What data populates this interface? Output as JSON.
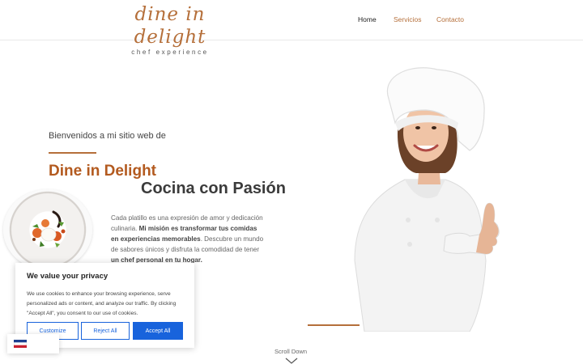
{
  "header": {
    "logo_main": "dine in delight",
    "logo_sub": "chef experience",
    "nav": {
      "home": "Home",
      "servicios": "Servicios",
      "contacto": "Contacto"
    }
  },
  "hero": {
    "welcome": "Bienvenidos a mi sitio web de",
    "title_1": "Dine in Delight",
    "title_2": "Cocina con Pasión",
    "para_1": "Cada platillo es una expresión de amor y dedicación culinaria. ",
    "para_bold_1": "Mi misión es transformar tus comidas en experiencias memorables",
    "para_2": ". Descubre un mundo de sabores únicos y disfruta la comodidad de tener ",
    "para_bold_2": "un chef personal en tu hogar."
  },
  "scroll": {
    "label": "Scroll Down",
    "icon": "chevron-down-icon"
  },
  "cookie_banner": {
    "title": "We value your privacy",
    "text": "We use cookies to enhance your browsing experience, serve personalized ads or content, and analyze our traffic. By clicking \"Accept All\", you consent to our use of cookies.",
    "customize_label": "Customize",
    "reject_label": "Reject All",
    "accept_label": "Accept All"
  },
  "colors": {
    "brand": "#b56f3a",
    "accent_blue": "#1863dc"
  }
}
